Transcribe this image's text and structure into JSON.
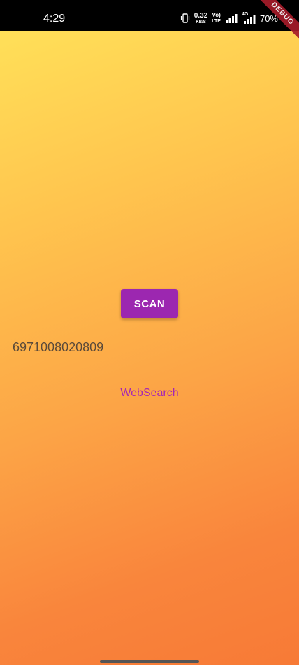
{
  "status_bar": {
    "time": "4:29",
    "net_speed_value": "0.32",
    "net_speed_unit": "KB/S",
    "volte_top": "Vo)",
    "volte_bottom": "LTE",
    "network_type": "4G",
    "battery": "70%",
    "icons": [
      "vibrate-icon",
      "signal-icon",
      "signal-4g-icon"
    ]
  },
  "debug_banner": {
    "label": "DEBUG"
  },
  "scan_button": {
    "label": "SCAN",
    "color": "#9C27B0"
  },
  "result_field": {
    "value": "6971008020809"
  },
  "websearch_button": {
    "label": "WebSearch",
    "color": "#A526B5"
  },
  "theme": {
    "gradient_start": "#FFE45A",
    "gradient_end": "#F77A36",
    "status_bar_bg": "#000000"
  }
}
